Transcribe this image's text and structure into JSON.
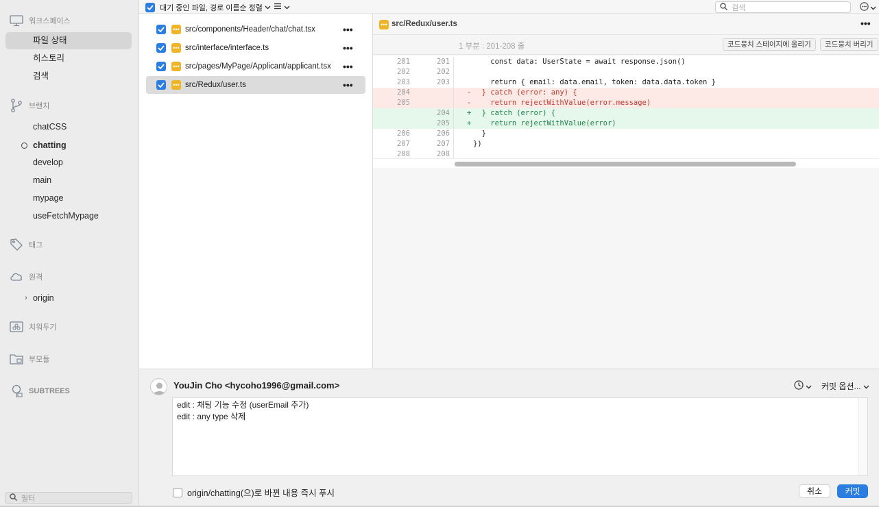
{
  "colors": {
    "accent": "#2a7de1",
    "modified": "#f0b429",
    "deleted_bg": "#fde9e6",
    "added_bg": "#e6f7ec"
  },
  "sidebar": {
    "workspace_title": "워크스페이스",
    "workspace_items": [
      {
        "label": "파일 상태",
        "selected": true
      },
      {
        "label": "히스토리"
      },
      {
        "label": "검색"
      }
    ],
    "branch_title": "브랜치",
    "branches": [
      {
        "label": "chatCSS"
      },
      {
        "label": "chatting",
        "current": true
      },
      {
        "label": "develop"
      },
      {
        "label": "main"
      },
      {
        "label": "mypage"
      },
      {
        "label": "useFetchMypage"
      }
    ],
    "tags_title": "태그",
    "remote_title": "원격",
    "remotes": [
      {
        "label": "origin"
      }
    ],
    "stash_title": "치워두기",
    "submodule_title": "부모듈",
    "subtrees_title": "SUBTREES",
    "filter_placeholder": "필터"
  },
  "topbar": {
    "sort_label": "대기 중인 파일, 경로 이름순 정렬",
    "search_placeholder": "검색"
  },
  "files": [
    {
      "path": "src/components/Header/chat/chat.tsx",
      "checked": true,
      "status_icon": "modified-icon"
    },
    {
      "path": "src/interface/interface.ts",
      "checked": true,
      "status_icon": "modified-icon"
    },
    {
      "path": "src/pages/MyPage/Applicant/applicant.tsx",
      "checked": true,
      "status_icon": "modified-icon"
    },
    {
      "path": "src/Redux/user.ts",
      "checked": true,
      "status_icon": "modified-icon",
      "selected": true
    }
  ],
  "diff": {
    "file_name": "src/Redux/user.ts",
    "hunk_range": "1 부분 : 201-208 줄",
    "stage_hunk_label": "코드뭉치 스테이지에 올리기",
    "discard_hunk_label": "코드뭉치 버리기",
    "lines": [
      {
        "old": "201",
        "new": "201",
        "sign": "",
        "type": "ctx",
        "text": "    const data: UserState = await response.json()"
      },
      {
        "old": "202",
        "new": "202",
        "sign": "",
        "type": "ctx",
        "text": ""
      },
      {
        "old": "203",
        "new": "203",
        "sign": "",
        "type": "ctx",
        "text": "    return { email: data.email, token: data.data.token }"
      },
      {
        "old": "204",
        "new": "",
        "sign": "-",
        "type": "del",
        "text": "  } catch (error: any) {"
      },
      {
        "old": "205",
        "new": "",
        "sign": "-",
        "type": "del",
        "text": "    return rejectWithValue(error.message)"
      },
      {
        "old": "",
        "new": "204",
        "sign": "+",
        "type": "add",
        "text": "  } catch (error) {"
      },
      {
        "old": "",
        "new": "205",
        "sign": "+",
        "type": "add",
        "text": "    return rejectWithValue(error)"
      },
      {
        "old": "206",
        "new": "206",
        "sign": "",
        "type": "ctx",
        "text": "  }"
      },
      {
        "old": "207",
        "new": "207",
        "sign": "",
        "type": "ctx",
        "text": "})"
      },
      {
        "old": "208",
        "new": "208",
        "sign": "",
        "type": "ctx",
        "text": ""
      }
    ]
  },
  "commit": {
    "author": "YouJin Cho <hycoho1996@gmail.com>",
    "options_label": "커밋 옵션...",
    "message_line1": "edit : 채팅 기능 수정 (userEmail 추가)",
    "message_line2": "edit : any type 삭제",
    "push_label": "origin/chatting(으)로 바뀐 내용 즉시 푸시",
    "push_checked": false,
    "cancel_label": "취소",
    "commit_label": "커밋"
  }
}
